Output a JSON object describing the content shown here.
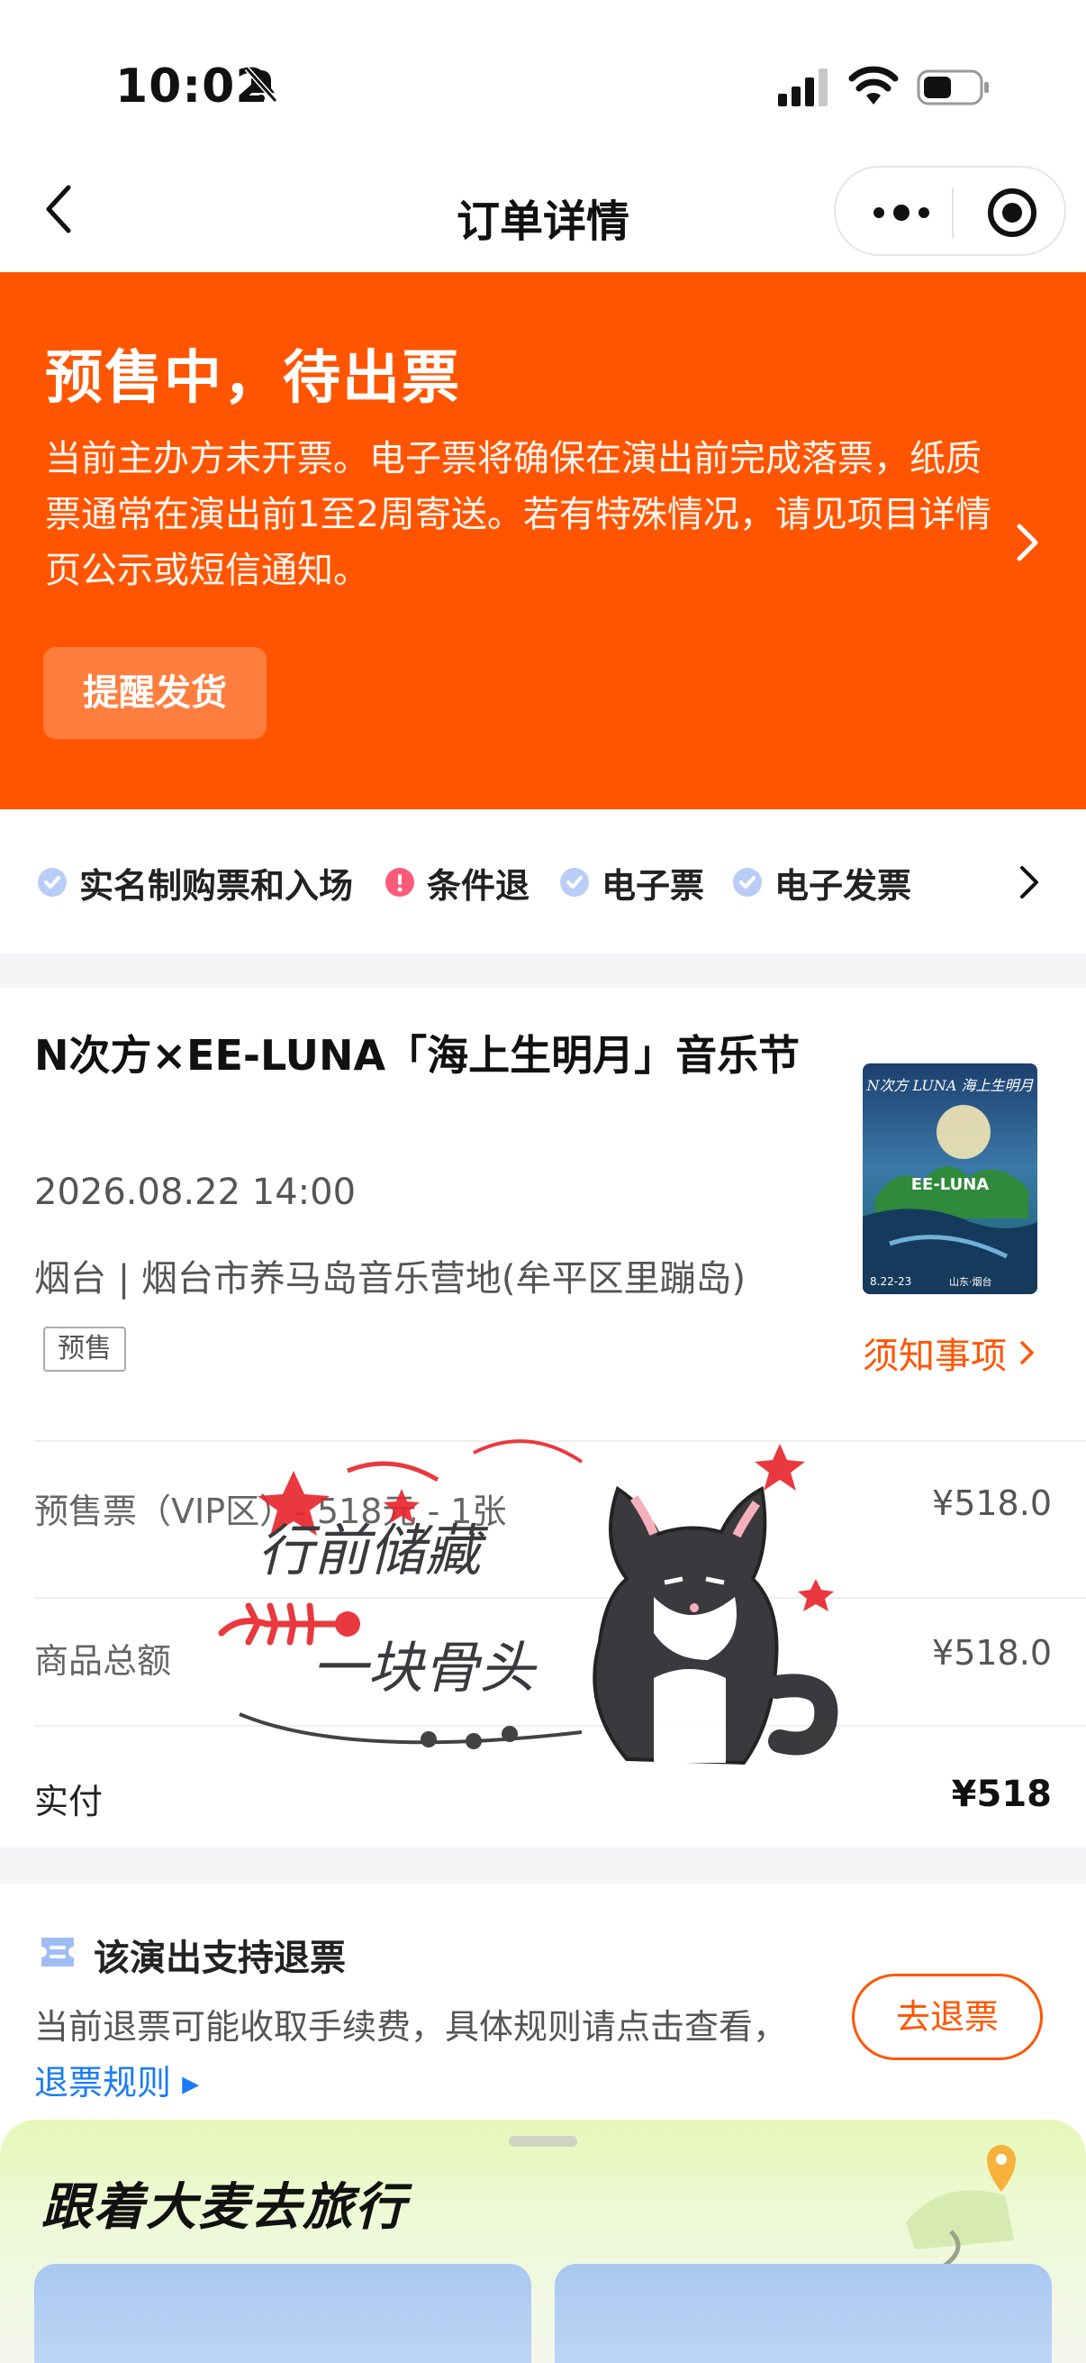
{
  "status_bar": {
    "time": "10:02"
  },
  "nav": {
    "title": "订单详情"
  },
  "banner": {
    "title": "预售中，待出票",
    "description": "当前主办方未开票。电子票将确保在演出前完成落票，纸质票通常在演出前1至2周寄送。若有特殊情况，请见项目详情页公示或短信通知。",
    "remind_button": "提醒发货"
  },
  "tags": [
    {
      "label": "实名制购票和入场",
      "status": "ok"
    },
    {
      "label": "条件退",
      "status": "warn"
    },
    {
      "label": "电子票",
      "status": "ok"
    },
    {
      "label": "电子发票",
      "status": "ok"
    }
  ],
  "event": {
    "title": "N次方×EE-LUNA「海上生明月」音乐节",
    "datetime": "2026.08.22 14:00",
    "venue": "烟台 | 烟台市养马岛音乐营地(牟平区里蹦岛)",
    "badge": "预售",
    "notice_link": "须知事项",
    "poster": {
      "title_text": "N次方 LUNA 海上生明月",
      "mid_text": "EE-LUNA",
      "date_text": "8.22-23",
      "place_text": "山东·烟台"
    }
  },
  "price": {
    "ticket_line": "预售票（VIP区）- 518元 - 1张",
    "ticket_amount": "¥518.0",
    "subtotal_label": "商品总额",
    "subtotal_amount": "¥518.0",
    "paid_label": "实付",
    "paid_amount": "¥518"
  },
  "sticker": {
    "text_line1": "行前储藏",
    "text_line2": "一块骨头"
  },
  "refund": {
    "title": "该演出支持退票",
    "description": "当前退票可能收取手续费，具体规则请点击查看，",
    "rule_link": "退票规则",
    "button": "去退票"
  },
  "travel": {
    "title": "跟着大麦去旅行"
  },
  "colors": {
    "brand_orange": "#ff5500",
    "link_blue": "#1a7cf5"
  },
  "icons": [
    "bell-slash-icon",
    "signal-icon",
    "wifi-icon",
    "battery-icon",
    "back-icon",
    "more-icon",
    "target-icon",
    "chevron-right-icon",
    "check-icon",
    "exclamation-icon",
    "ticket-icon",
    "location-pin-icon"
  ]
}
